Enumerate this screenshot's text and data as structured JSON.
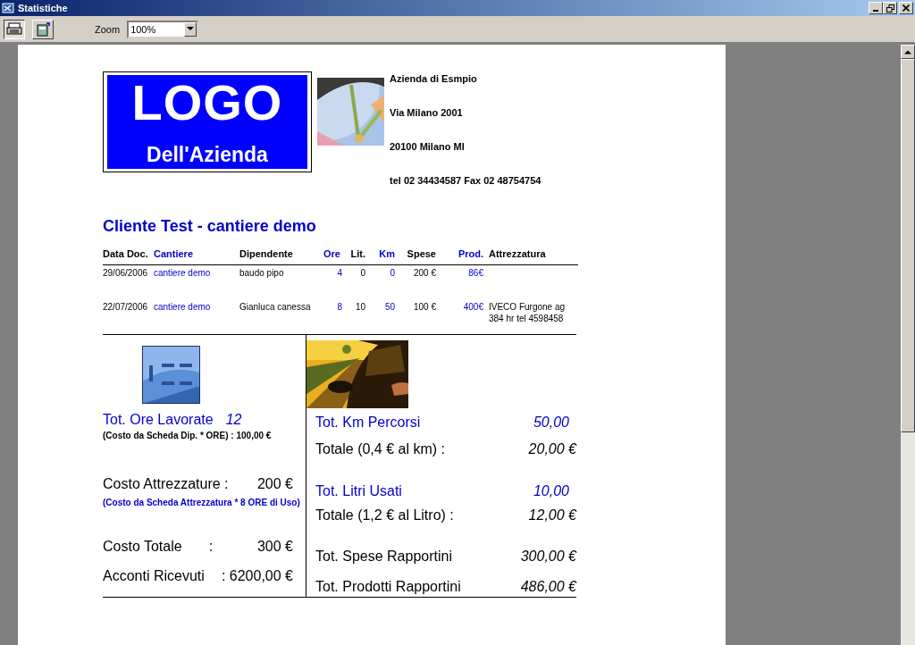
{
  "window": {
    "title": "Statistiche"
  },
  "toolbar": {
    "buttons": [
      {
        "kind": "print",
        "pressed": true
      },
      {
        "kind": "page",
        "pressed": false
      }
    ],
    "zoom": {
      "label": "Zoom",
      "value": "100%"
    }
  },
  "report": {
    "logo": {
      "line1": "LOGO",
      "line2": "Dell'Azienda"
    },
    "company": [
      "Azienda di Esmpio",
      "Via Milano 2001",
      "20100 Milano MI",
      "tel 02 34434587  Fax 02 48754754"
    ],
    "title": "Cliente Test - cantiere demo",
    "columns": [
      {
        "label": "Data Doc.",
        "color": "#000000"
      },
      {
        "label": "Cantiere",
        "color": "#0000cc"
      },
      {
        "label": "Dipendente",
        "color": "#000000"
      },
      {
        "label": "Ore",
        "color": "#0000cc"
      },
      {
        "label": "Lit.",
        "color": "#000000"
      },
      {
        "label": "Km",
        "color": "#0000cc"
      },
      {
        "label": "Spese",
        "color": "#000000"
      },
      {
        "label": "Prod.",
        "color": "#0000cc"
      },
      {
        "label": "Attrezzatura",
        "color": "#000000"
      }
    ],
    "rows": [
      {
        "cells": [
          "29/06/2006",
          "cantiere demo",
          "baudo pipo",
          "4",
          "0",
          "0",
          "200 €",
          "86€",
          ""
        ]
      },
      {
        "cells": [
          "22/07/2006",
          "cantiere demo",
          "Gianluca canessa",
          "8",
          "10",
          "50",
          "100 €",
          "400€",
          "IVECO Furgone ag 384 hr tel 4598458"
        ]
      }
    ],
    "left": [
      {
        "kind": "picture"
      },
      {
        "kind": "total",
        "label": "Tot. Ore Lavorate",
        "value": "12"
      },
      {
        "kind": "note",
        "text": "(Costo da Scheda Dip. * ORE) : 100,00  €",
        "color": "#000000"
      },
      {
        "kind": "line",
        "label": "Costo Attrezzature :",
        "value": "200 €"
      },
      {
        "kind": "note",
        "text": "(Costo da Scheda Attrezzatura * 8 ORE di Uso)",
        "color": "#0000cc"
      },
      {
        "kind": "line",
        "label": "Costo Totale",
        "sep": ":",
        "value": "300 €"
      },
      {
        "kind": "line",
        "label": "Acconti Ricevuti",
        "value": ": 6200,00 €"
      }
    ],
    "right": [
      {
        "kind": "picture"
      },
      {
        "kind": "total",
        "label": "Tot. Km Percorsi",
        "value": "50,00"
      },
      {
        "kind": "line",
        "label": "Totale (0,4 € al km) :",
        "value": "20,00 €"
      },
      {
        "kind": "total",
        "label": "Tot. Litri Usati",
        "value": "10,00"
      },
      {
        "kind": "line",
        "label": "Totale (1,2 € al Litro) :",
        "value": "12,00 €"
      },
      {
        "kind": "line",
        "label": "Tot. Spese Rapportini",
        "value": "300,00 €"
      },
      {
        "kind": "line",
        "label": "Tot. Prodotti Rapportini",
        "value": "486,00 €"
      }
    ]
  }
}
